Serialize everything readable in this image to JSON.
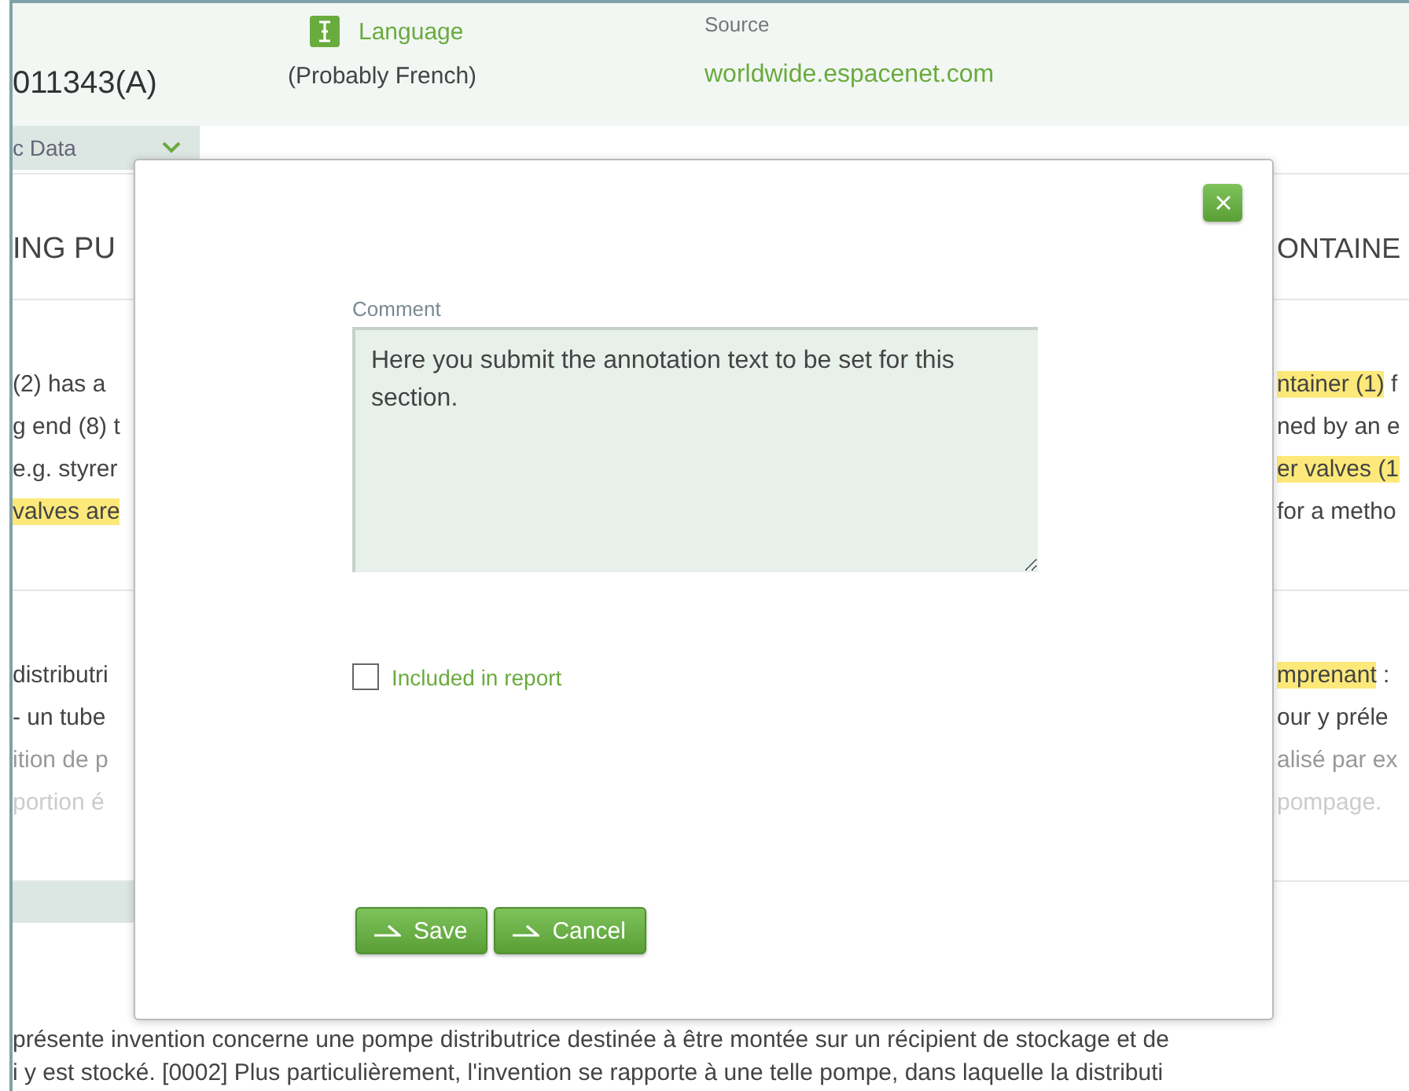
{
  "header": {
    "document_number": "011343(A)",
    "language": {
      "label": "Language",
      "value": "(Probably French)"
    },
    "source": {
      "label": "Source",
      "value": "worldwide.espacenet.com"
    }
  },
  "tab": {
    "label": "c Data"
  },
  "title_row": {
    "left": "ING PU",
    "right": "ONTAINE"
  },
  "sections": [
    {
      "left": [
        {
          "kind": "normal",
          "segments": [
            {
              "text": "(2) has a",
              "highlighted": false
            }
          ]
        },
        {
          "kind": "normal",
          "segments": [
            {
              "text": "g end (8) t",
              "highlighted": false
            }
          ]
        },
        {
          "kind": "normal",
          "segments": [
            {
              "text": "e.g. styrer",
              "highlighted": false
            }
          ]
        },
        {
          "kind": "normal",
          "segments": [
            {
              "text": "valves are",
              "highlighted": true
            }
          ]
        }
      ],
      "right": [
        {
          "kind": "normal",
          "segments": [
            {
              "text": "ntainer (1)",
              "highlighted": true
            },
            {
              "text": " f",
              "highlighted": false
            }
          ]
        },
        {
          "kind": "normal",
          "segments": [
            {
              "text": "ned by an e",
              "highlighted": false
            }
          ]
        },
        {
          "kind": "normal",
          "segments": [
            {
              "text": "er valves (1",
              "highlighted": true
            }
          ]
        },
        {
          "kind": "normal",
          "segments": [
            {
              "text": "for a metho",
              "highlighted": false
            }
          ]
        }
      ]
    },
    {
      "left": [
        {
          "kind": "normal",
          "segments": [
            {
              "text": "distributri",
              "highlighted": false
            }
          ]
        },
        {
          "kind": "normal",
          "segments": [
            {
              "text": "- un tube",
              "highlighted": false
            }
          ]
        },
        {
          "kind": "muted",
          "segments": [
            {
              "text": "ition de p",
              "highlighted": false
            }
          ]
        },
        {
          "kind": "faint",
          "segments": [
            {
              "text": "portion é",
              "highlighted": false
            }
          ]
        }
      ],
      "right": [
        {
          "kind": "normal",
          "segments": [
            {
              "text": "mprenant",
              "highlighted": true
            },
            {
              "text": " :",
              "highlighted": false
            }
          ]
        },
        {
          "kind": "normal",
          "segments": [
            {
              "text": "our y préle",
              "highlighted": false
            }
          ]
        },
        {
          "kind": "muted",
          "segments": [
            {
              "text": "alisé par ex",
              "highlighted": false
            }
          ]
        },
        {
          "kind": "faint",
          "segments": [
            {
              "text": "pompage.",
              "highlighted": false
            }
          ]
        }
      ]
    }
  ],
  "description_lines": [
    "présente invention concerne une pompe distributrice destinée à être montée sur un récipient de stockage et de",
    "i y est stocké. [0002] Plus particulièrement, l'invention se rapporte à une telle pompe, dans laquelle la distributi"
  ],
  "modal": {
    "comment_label": "Comment",
    "comment_value": "Here you submit the annotation text to be set for this section.",
    "included_in_report": {
      "label": "Included in report",
      "checked": false
    },
    "buttons": [
      "Save",
      "Cancel"
    ]
  }
}
